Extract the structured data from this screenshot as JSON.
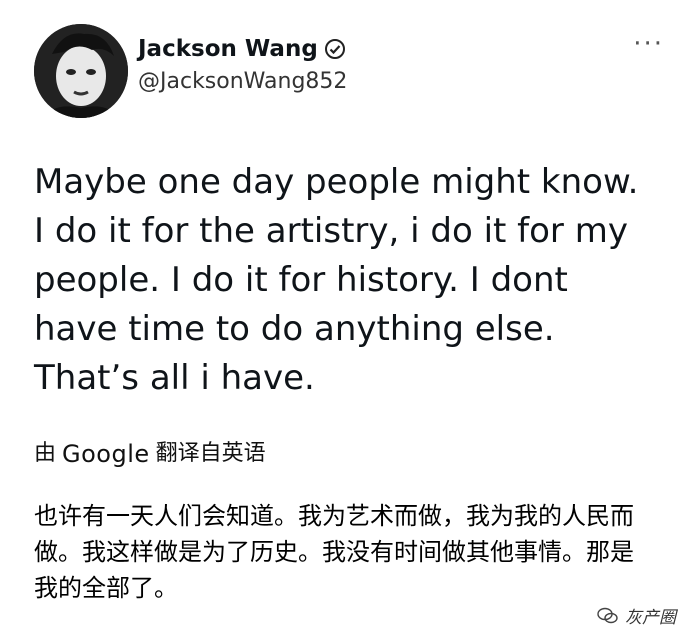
{
  "author": {
    "display_name": "Jackson Wang",
    "handle": "@JacksonWang852",
    "verified_icon": "verified-badge-icon"
  },
  "menu": {
    "more_label": "···"
  },
  "tweet": {
    "text": "Maybe one day people might know. I do it for the artistry, i do it for my people. I do it for history. I dont have time to do anything else. That’s all i have."
  },
  "translation": {
    "prefix": "由",
    "provider": "Google",
    "suffix": "翻译自英语",
    "text": "也许有一天人们会知道。我为艺术而做，我为我的人民而做。我这样做是为了历史。我没有时间做其他事情。那是我的全部了。"
  },
  "watermark": {
    "label": "灰产圈",
    "icon": "wechat-icon"
  }
}
